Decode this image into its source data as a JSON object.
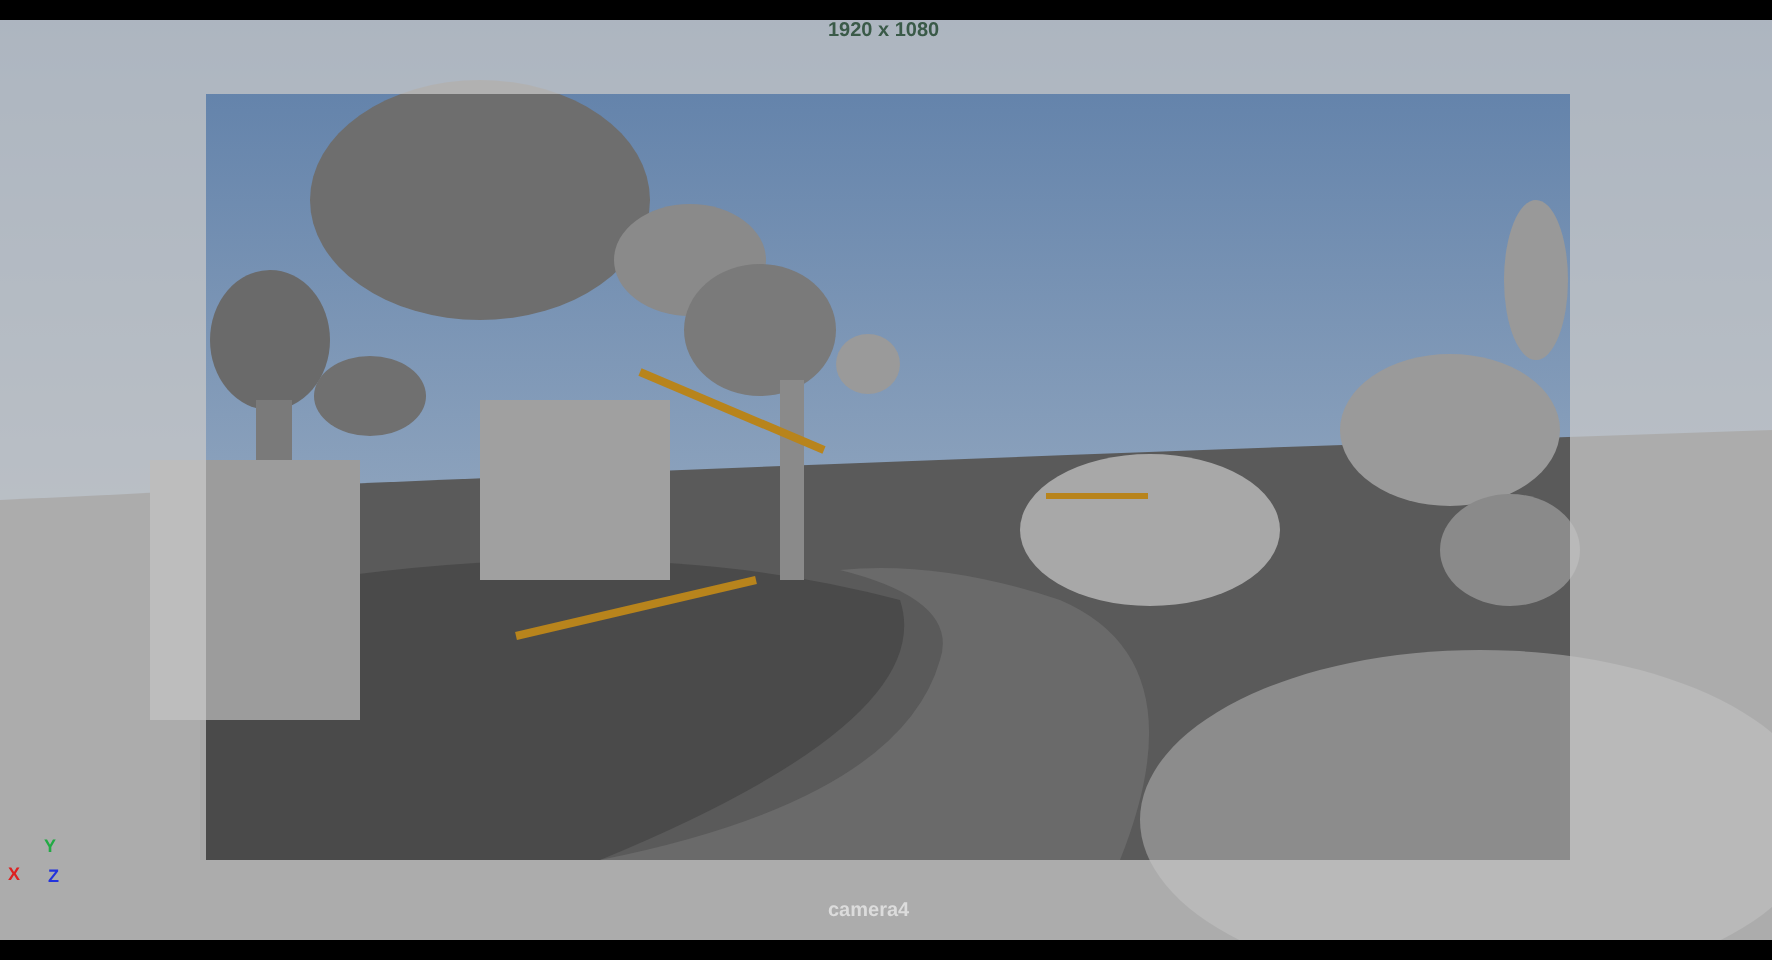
{
  "viewport": {
    "resolution_label": "1920 x 1080",
    "camera_label": "camera4",
    "axis_labels": [
      {
        "label": "Y",
        "color": "#22aa44"
      },
      {
        "label": "X",
        "color": "#dd2222"
      },
      {
        "label": "Z",
        "color": "#2233dd"
      }
    ]
  }
}
